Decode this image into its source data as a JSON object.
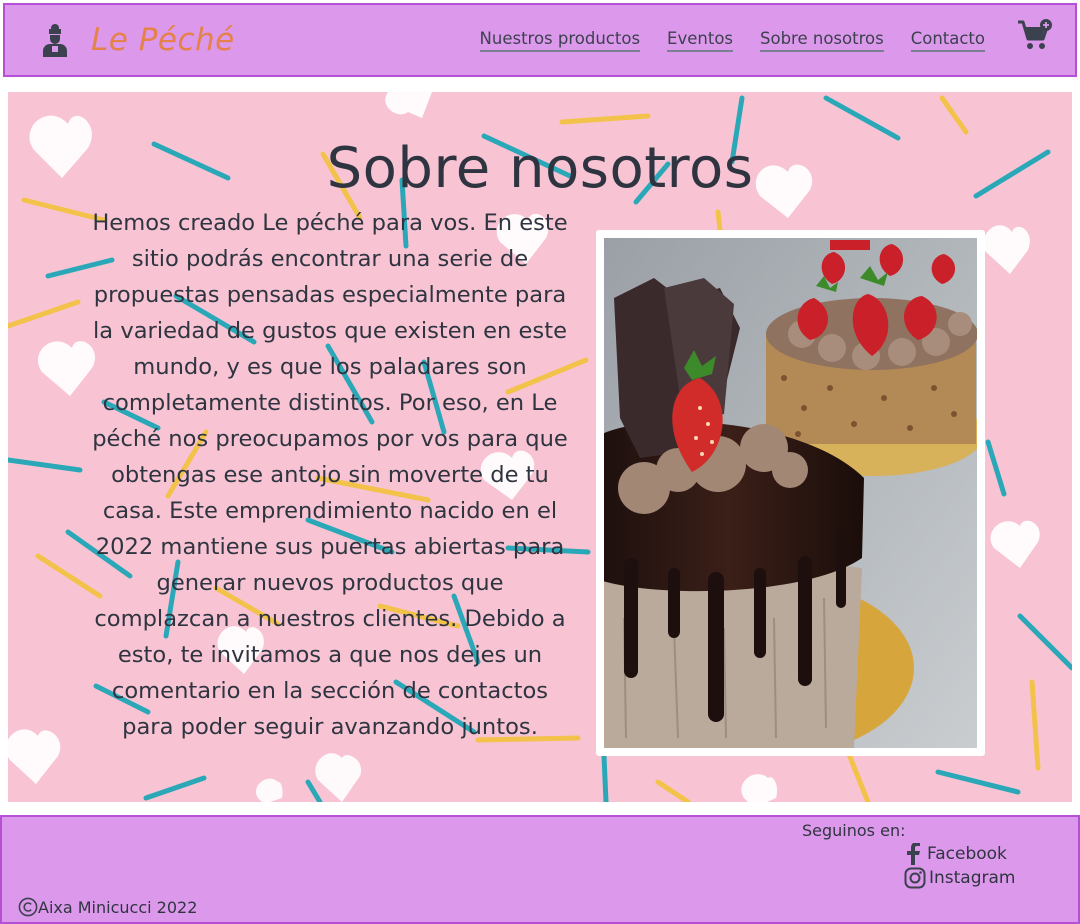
{
  "header": {
    "brand": "Le Péché",
    "logo_icon": "chef-icon",
    "nav": [
      {
        "label": "Nuestros productos"
      },
      {
        "label": "Eventos"
      },
      {
        "label": "Sobre nosotros"
      },
      {
        "label": "Contacto"
      }
    ],
    "cart_icon": "cart-add-icon"
  },
  "main": {
    "title": "Sobre nosotros",
    "paragraph": "Hemos creado Le péché para vos. En este sitio podrás encontrar una serie de propuestas pensadas especialmente para la variedad de gustos que existen en este mundo, y es que los paladares son completamente distintos. Por eso, en Le péché nos preocupamos por vos para que obtengas ese antojo sin moverte de tu casa. Este emprendimiento nacido en el 2022 mantiene sus puertas abiertas para generar nuevos productos que complazcan a nuestros clientes. Debido a esto, te invitamos a que nos dejes un comentario en la sección de contactos para poder seguir avanzando juntos."
  },
  "footer": {
    "follow_label": "Seguinos en:",
    "social": [
      {
        "label": "Facebook",
        "icon": "facebook-icon"
      },
      {
        "label": "Instagram",
        "icon": "instagram-icon"
      }
    ],
    "copyright": "Aixa Minicucci 2022"
  },
  "colors": {
    "header_bg": "#dc98ea",
    "border": "#b44fd6",
    "brand": "#e4824a",
    "text": "#2f3540",
    "hero_bg": "#f8c4d4"
  }
}
